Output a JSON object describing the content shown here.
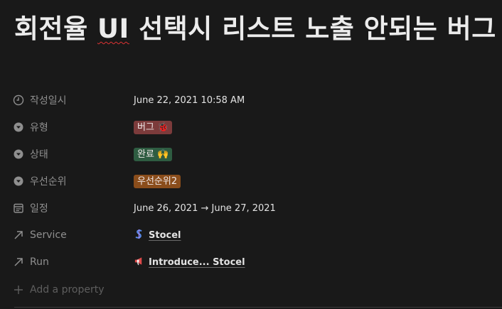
{
  "page": {
    "title_pre": "회전율 ",
    "title_ui": "UI",
    "title_post": " 선택시 리스트 노출 안되는 버그"
  },
  "properties": [
    {
      "name": "작성일시",
      "icon": "clock-icon",
      "value": "June 22, 2021 10:58 AM"
    },
    {
      "name": "유형",
      "icon": "select-icon",
      "value": "버그 🐞",
      "tag_color": "#7c3b3b"
    },
    {
      "name": "상태",
      "icon": "select-icon",
      "value": "완료 🙌",
      "tag_color": "#2e5c41"
    },
    {
      "name": "우선순위",
      "icon": "select-icon",
      "value": "우선순위2",
      "tag_color": "#8a4d1b"
    },
    {
      "name": "일정",
      "icon": "calendar-icon",
      "value": "June 26, 2021 → June 27, 2021"
    },
    {
      "name": "Service",
      "icon": "arrow-up-right-icon",
      "value_icon": "stocel-logo-icon",
      "value": "Stocel"
    },
    {
      "name": "Run",
      "icon": "arrow-up-right-icon",
      "value_icon": "megaphone-icon",
      "value": "Introduce... Stocel"
    }
  ],
  "add_property": {
    "label": "Add a property",
    "icon": "plus-icon"
  }
}
